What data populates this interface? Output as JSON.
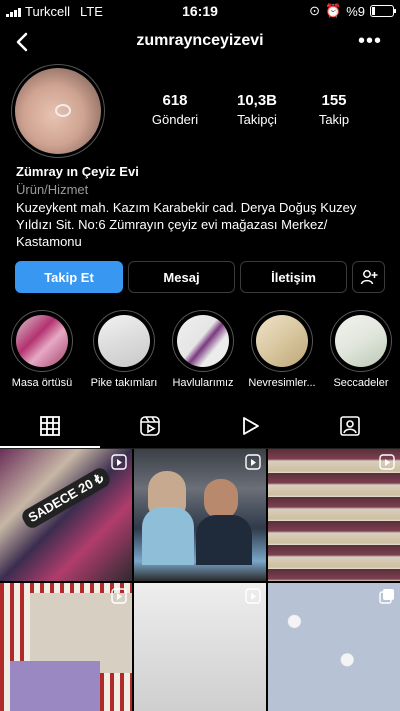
{
  "status_bar": {
    "carrier": "Turkcell",
    "network": "LTE",
    "time": "16:19",
    "battery": "%9"
  },
  "header": {
    "username": "zumraynceyizevi"
  },
  "profile": {
    "stats": [
      {
        "value": "618",
        "label": "Gönderi"
      },
      {
        "value": "10,3B",
        "label": "Takipçi"
      },
      {
        "value": "155",
        "label": "Takip"
      }
    ],
    "name": "Zümray ın Çeyiz Evi",
    "category": "Ürün/Hizmet",
    "bio": "Kuzeykent mah. Kazım Karabekir cad. Derya Doğuş Kuzey Yıldızı Sit. No:6 Zümrayın çeyiz evi mağazası Merkez/ Kastamonu"
  },
  "actions": {
    "follow": "Takip Et",
    "message": "Mesaj",
    "contact": "İletişim"
  },
  "highlights": [
    {
      "label": "Masa örtüsü"
    },
    {
      "label": "Pike takımları"
    },
    {
      "label": "Havlularımız"
    },
    {
      "label": "Nevresimler..."
    },
    {
      "label": "Seccadeler"
    }
  ],
  "tabs": [
    "grid-icon",
    "reels-icon",
    "video-icon",
    "tagged-icon"
  ],
  "grid": {
    "first_post_text": "SADECE 20 ₺"
  },
  "colors": {
    "accent": "#3897f0",
    "background": "#000000"
  }
}
